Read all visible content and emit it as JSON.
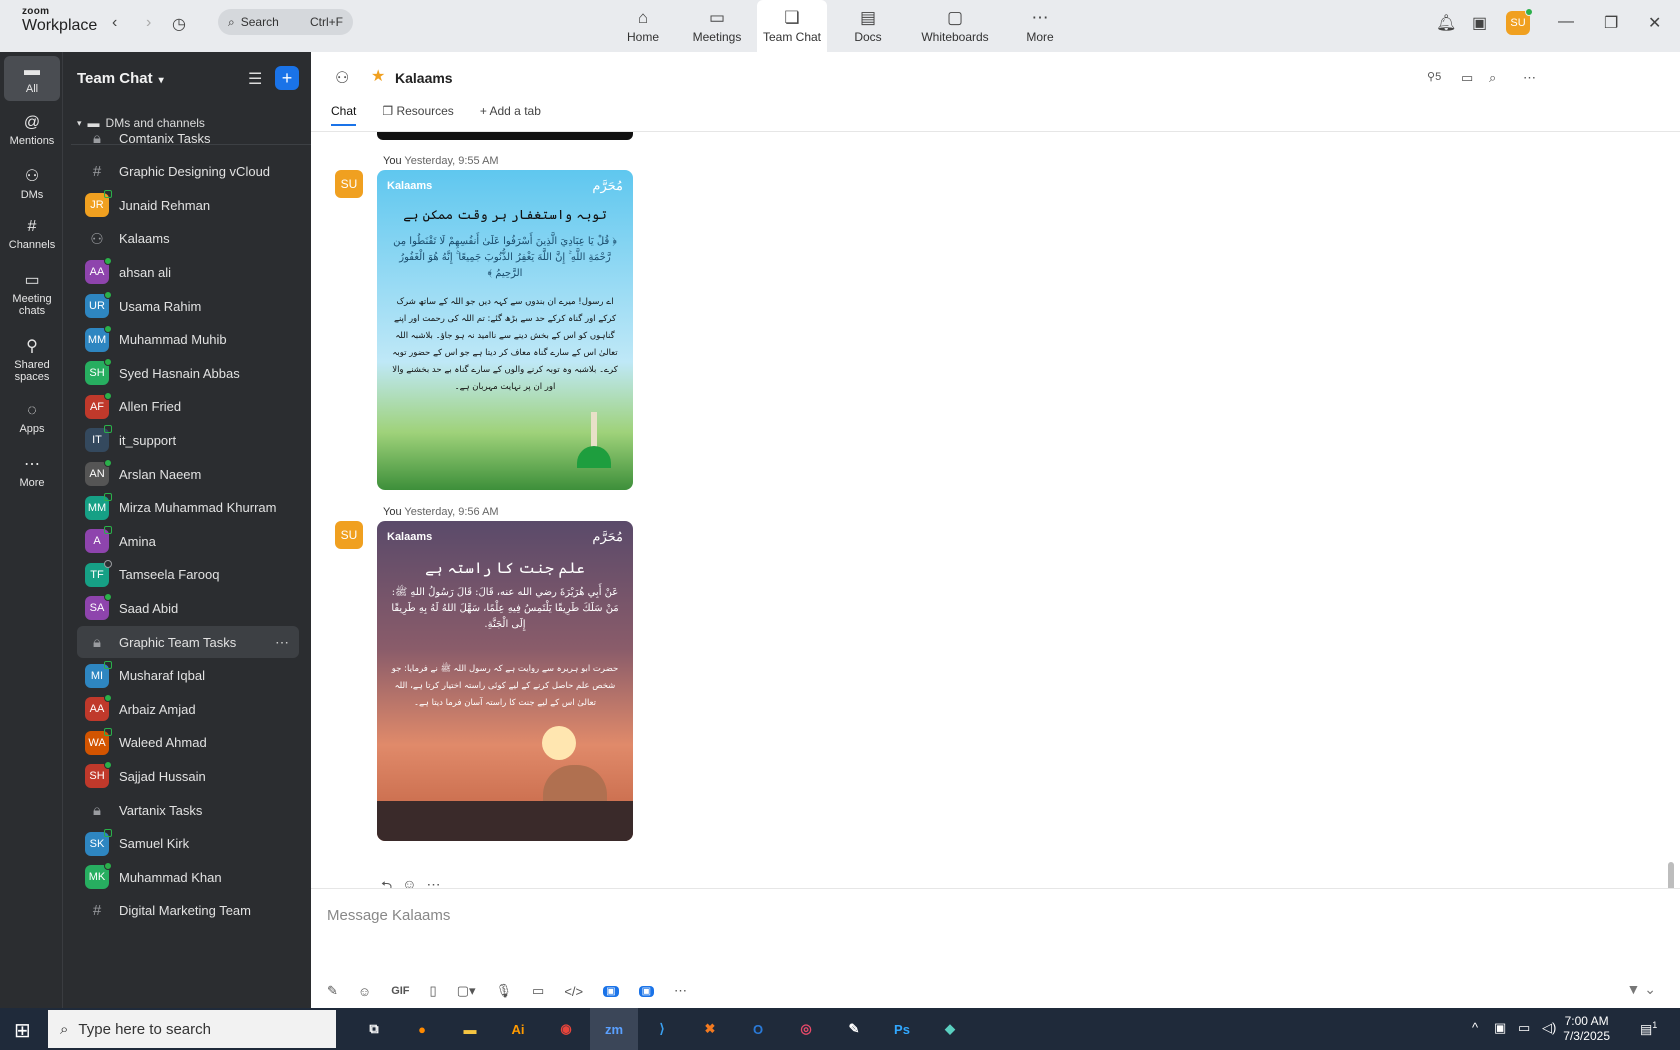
{
  "app": {
    "brand_line1": "zoom",
    "brand_line2": "Workplace"
  },
  "search": {
    "label": "Search",
    "shortcut": "Ctrl+F"
  },
  "nav_tabs": [
    {
      "label": "Home",
      "icon": "home-icon"
    },
    {
      "label": "Meetings",
      "icon": "video-icon"
    },
    {
      "label": "Team Chat",
      "icon": "chat-icon"
    },
    {
      "label": "Docs",
      "icon": "doc-icon"
    },
    {
      "label": "Whiteboards",
      "icon": "whiteboard-icon"
    },
    {
      "label": "More",
      "icon": "dots-icon"
    }
  ],
  "user": {
    "initials": "SU"
  },
  "rail": [
    {
      "label": "All"
    },
    {
      "label": "Mentions"
    },
    {
      "label": "DMs"
    },
    {
      "label": "Channels"
    },
    {
      "label": "Meeting chats"
    },
    {
      "label": "Shared spaces"
    },
    {
      "label": "Apps"
    },
    {
      "label": "More"
    }
  ],
  "sidebar": {
    "title": "Team Chat",
    "section": "DMs and channels",
    "items": [
      {
        "name": "Comtanix Tasks",
        "initials": "",
        "kind": "lock"
      },
      {
        "name": "Graphic Designing vCloud",
        "initials": "",
        "kind": "hash"
      },
      {
        "name": "Junaid Rehman",
        "initials": "JR",
        "color": "#f0a020"
      },
      {
        "name": "Kalaams",
        "initials": "",
        "kind": "group"
      },
      {
        "name": "ahsan ali",
        "initials": "AA",
        "color": "#8e44ad"
      },
      {
        "name": "Usama Rahim",
        "initials": "UR",
        "color": "#2e86c1"
      },
      {
        "name": "Muhammad Muhib",
        "initials": "MM",
        "color": "#2e86c1"
      },
      {
        "name": "Syed Hasnain Abbas",
        "initials": "SH",
        "color": "#27ae60"
      },
      {
        "name": "Allen Fried",
        "initials": "AF",
        "color": "#c0392b"
      },
      {
        "name": "it_support",
        "initials": "IT",
        "color": "#34495e"
      },
      {
        "name": "Arslan Naeem",
        "initials": "AN",
        "color": "#555555"
      },
      {
        "name": "Mirza Muhammad Khurram",
        "initials": "MM",
        "color": "#16a085"
      },
      {
        "name": "Amina",
        "initials": "A",
        "color": "#8e44ad"
      },
      {
        "name": "Tamseela Farooq",
        "initials": "TF",
        "color": "#16a085"
      },
      {
        "name": "Saad Abid",
        "initials": "SA",
        "color": "#8e44ad"
      },
      {
        "name": "Graphic Team Tasks",
        "initials": "",
        "kind": "lock"
      },
      {
        "name": "Musharaf Iqbal",
        "initials": "MI",
        "color": "#2e86c1"
      },
      {
        "name": "Arbaiz Amjad",
        "initials": "AA",
        "color": "#c0392b"
      },
      {
        "name": "Waleed Ahmad",
        "initials": "WA",
        "color": "#d35400"
      },
      {
        "name": "Sajjad Hussain",
        "initials": "SH",
        "color": "#c0392b"
      },
      {
        "name": "Vartanix Tasks",
        "initials": "",
        "kind": "lock"
      },
      {
        "name": "Samuel Kirk",
        "initials": "SK",
        "color": "#2e86c1"
      },
      {
        "name": "Muhammad Khan",
        "initials": "MK",
        "color": "#27ae60"
      },
      {
        "name": "Digital Marketing Team",
        "initials": "",
        "kind": "hash"
      }
    ]
  },
  "channel": {
    "title": "Kalaams",
    "members": "5"
  },
  "tabs": {
    "chat": "Chat",
    "resources": "Resources",
    "add": "Add a tab"
  },
  "messages": [
    {
      "sender": "You",
      "time": "Yesterday, 9:55 AM",
      "avatar": "SU",
      "brand": "Kalaams",
      "brand2": "مُحَرَّم",
      "title": "توبہ واستغفار ہر وقت ممکن ہے",
      "ayah": "﴿ قُلْ يَا عِبَادِيَ الَّذِينَ أَسْرَفُوا عَلَىٰ أَنفُسِهِمْ لَا تَقْنَطُوا مِن رَّحْمَةِ اللَّهِ ۚ إِنَّ اللَّهَ يَغْفِرُ الذُّنُوبَ جَمِيعًا ۚ إِنَّهُ هُوَ الْغَفُورُ الرَّحِيمُ ﴾",
      "body": "اے رسول! میرے ان بندوں سے کہہ دیں جو اللہ کے ساتھ شرک کرکے اور گناہ کرکے حد سے بڑھ گئے: تم اللہ کی رحمت اور اپنے گناہوں کو اس کے بخش دینے سے ناامید نہ ہو جاؤ۔ بلاشبہ اللہ تعالیٰ اس کے سارے گناہ معاف کر دیتا ہے جو اس کے حضور توبہ کرے۔ بلاشبہ وہ توبہ کرنے والوں کے سارے گناہ بے حد بخشنے والا اور ان پر نہایت مہربان ہے۔"
    },
    {
      "sender": "You",
      "time": "Yesterday, 9:56 AM",
      "avatar": "SU",
      "brand": "Kalaams",
      "brand2": "مُحَرَّم",
      "title": "علم جنت کا راستہ ہے",
      "ayah": "عَنْ أَبِي هُرَيْرَةَ رضي الله عنه، قَالَ: قَالَ رَسُولُ اللهِ ﷺ: مَنْ سَلَكَ طَرِيقًا يَلْتَمِسُ فِيهِ عِلْمًا، سَهَّلَ اللهُ لَهُ بِهِ طَرِيقًا إِلَى الْجَنَّةِ.",
      "body": "حضرت ابو ہریرہ سے روایت ہے کہ رسول اللہ ﷺ نے فرمایا: جو شخص علم حاصل کرنے کے لیے کوئی راستہ اختیار کرتا ہے، اللہ تعالیٰ اس کے لیے جنت کا راستہ آسان فرما دیتا ہے۔"
    }
  ],
  "composer": {
    "placeholder": "Message Kalaams",
    "gif": "GIF"
  },
  "taskbar": {
    "search_placeholder": "Type here to search",
    "time": "7:00 AM",
    "date": "7/3/2025",
    "notifications": "1"
  }
}
